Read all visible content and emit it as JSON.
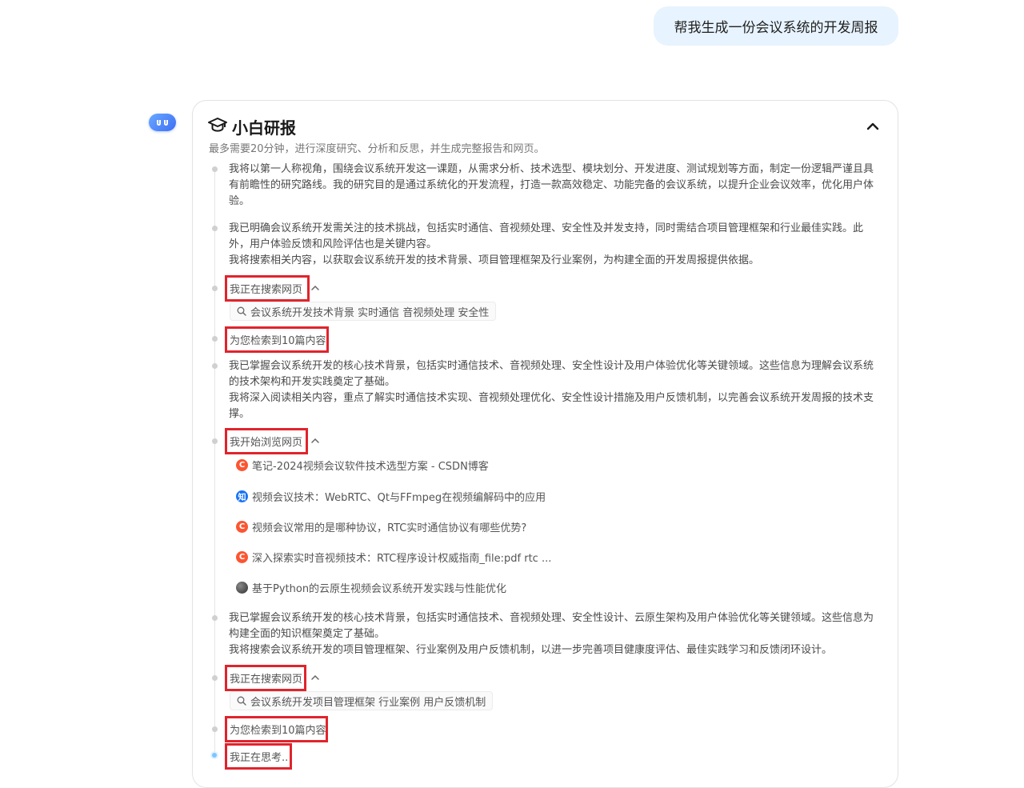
{
  "user_message": "帮我生成一份会议系统的开发周报",
  "card": {
    "title": "小白研报",
    "subtitle": "最多需要20分钟，进行深度研究、分析和反思，并生成完整报告和网页。"
  },
  "timeline": {
    "para1": "我将以第一人称视角，围绕会议系统开发这一课题，从需求分析、技术选型、模块划分、开发进度、测试规划等方面，制定一份逻辑严谨且具有前瞻性的研究路线。我的研究目的是通过系统化的开发流程，打造一款高效稳定、功能完备的会议系统，以提升企业会议效率，优化用户体验。",
    "para2_line1": "我已明确会议系统开发需关注的技术挑战，包括实时通信、音视频处理、安全性及并发支持，同时需结合项目管理框架和行业最佳实践。此外，用户体验反馈和风险评估也是关键内容。",
    "para2_line2": "我将搜索相关内容，以获取会议系统开发的技术背景、项目管理框架及行业案例，为构建全面的开发周报提供依据。",
    "step_search1": "我正在搜索网页",
    "query1": "会议系统开发技术背景 实时通信 音视频处理 安全性",
    "step_found1": "为您检索到10篇内容",
    "para3_line1": "我已掌握会议系统开发的核心技术背景，包括实时通信技术、音视频处理、安全性设计及用户体验优化等关键领域。这些信息为理解会议系统的技术架构和开发实践奠定了基础。",
    "para3_line2": "我将深入阅读相关内容，重点了解实时通信技术实现、音视频处理优化、安全性设计措施及用户反馈机制，以完善会议系统开发周报的技术支撑。",
    "step_browse": "我开始浏览网页",
    "sources": [
      {
        "icon": "csdn-icon",
        "title": "笔记-2024视频会议软件技术选型方案 - CSDN博客"
      },
      {
        "icon": "zhihu-icon",
        "title": "视频会议技术：WebRTC、Qt与FFmpeg在视频编解码中的应用"
      },
      {
        "icon": "csdn-icon",
        "title": "视频会议常用的是哪种协议，RTC实时通信协议有哪些优势?"
      },
      {
        "icon": "csdn-icon",
        "title": "深入探索实时音视频技术：RTC程序设计权威指南_file:pdf rtc ..."
      },
      {
        "icon": "author-avatar-icon",
        "title": "基于Python的云原生视频会议系统开发实践与性能优化"
      }
    ],
    "para4_line1": "我已掌握会议系统开发的核心技术背景，包括实时通信技术、音视频处理、安全性设计、云原生架构及用户体验优化等关键领域。这些信息为构建全面的知识框架奠定了基础。",
    "para4_line2": "我将搜索会议系统开发的项目管理框架、行业案例及用户反馈机制，以进一步完善项目健康度评估、最佳实践学习和反馈闭环设计。",
    "step_search2": "我正在搜索网页",
    "query2": "会议系统开发项目管理框架 行业案例 用户反馈机制",
    "step_found2": "为您检索到10篇内容",
    "step_thinking": "我正在思考..",
    "zhihu_glyph": "知",
    "csdn_glyph": "C"
  }
}
